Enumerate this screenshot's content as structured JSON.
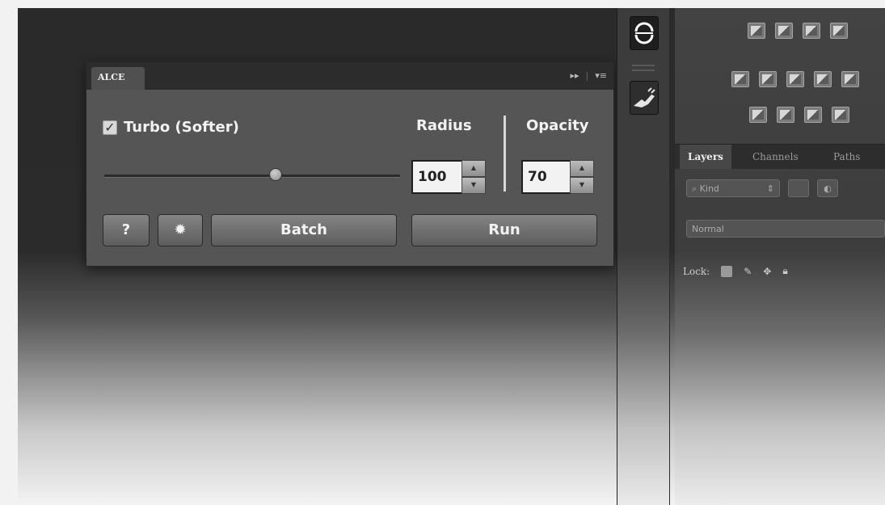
{
  "alce": {
    "tab_title": "ALCE",
    "expand_icon": "double-chevron-right-icon",
    "menu_icon": "panel-menu-icon",
    "turbo": {
      "label": "Turbo (Softer)",
      "checked": true
    },
    "slider": {
      "value_fraction": 0.58
    },
    "radius": {
      "label": "Radius",
      "value": "100"
    },
    "opacity": {
      "label": "Opacity",
      "value": "70"
    },
    "buttons": {
      "help": "?",
      "settings_icon": "gear-icon",
      "batch": "Batch",
      "run": "Run"
    }
  },
  "right_panel": {
    "tabs": [
      "Layers",
      "Channels",
      "Paths"
    ],
    "kind_filter": "Kind",
    "blend_mode": "Normal",
    "lock_label": "Lock:"
  }
}
